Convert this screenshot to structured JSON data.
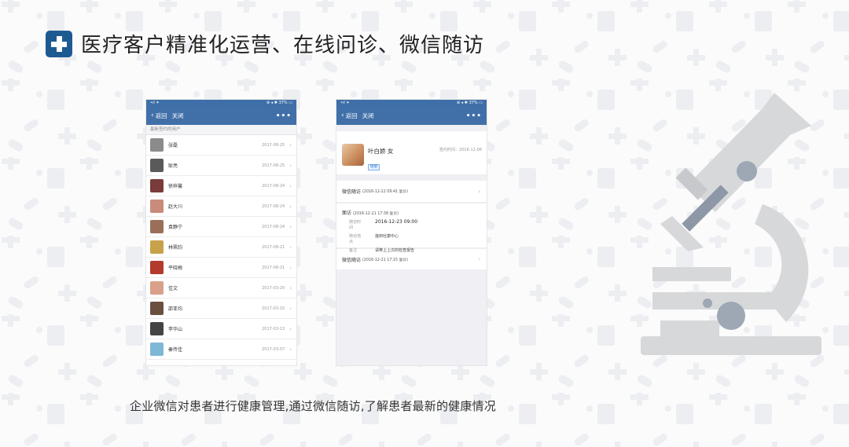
{
  "title": "医疗客户精准化运营、在线问诊、微信随访",
  "caption": "企业微信对患者进行健康管理,通过微信随访,了解患者最新的健康情况",
  "left_phone": {
    "status": {
      "left": "•ıl ✦",
      "right": "⊕ ◂ ✱ 37% ▭"
    },
    "nav": {
      "back": "返回",
      "close": "关闭",
      "more": "•••"
    },
    "section": "最新签约的用户",
    "users": [
      {
        "name": "张磊",
        "date": "2017-08-25",
        "color": "#8b8b8b"
      },
      {
        "name": "耿亮",
        "date": "2017-08-25",
        "color": "#5a5a5a"
      },
      {
        "name": "徐梓馨",
        "date": "2017-08-24",
        "color": "#7a3b3b"
      },
      {
        "name": "赵大川",
        "date": "2017-08-24",
        "color": "#c98c7a"
      },
      {
        "name": "袁静宁",
        "date": "2017-08-24",
        "color": "#9a6f5a"
      },
      {
        "name": "林珮钧",
        "date": "2017-08-21",
        "color": "#c7a24a"
      },
      {
        "name": "平晓梅",
        "date": "2017-08-21",
        "color": "#b33a2c"
      },
      {
        "name": "佳文",
        "date": "2017-03-20",
        "color": "#d9a08a"
      },
      {
        "name": "邵亚均",
        "date": "2017-03-15",
        "color": "#6b5040"
      },
      {
        "name": "李华山",
        "date": "2017-03-13",
        "color": "#444444"
      },
      {
        "name": "秦传佳",
        "date": "2017-03-07",
        "color": "#7fb7d6"
      }
    ]
  },
  "right_phone": {
    "status": {
      "left": "•ıl ✦",
      "right": "⊕ ◂ ✱ 37% ▭"
    },
    "nav": {
      "back": "返回",
      "close": "关闭",
      "more": "•••"
    },
    "profile": {
      "name": "叶白娇 女",
      "tag": "健康",
      "sign_label": "签约时间：2016-12-06"
    },
    "visit1": {
      "label": "微信随访",
      "date": "(2016-12-22 09:41 复诊)"
    },
    "meeting": {
      "label": "面访",
      "date": "(2016-12-21 17:38 复诊)",
      "time_key": "随访时间",
      "time_val": "2016-12-23 09:00",
      "place_key": "随访地点",
      "place_val": "莲田社康中心",
      "note_key": "备注",
      "note_val": "请带上上次的检查报告"
    },
    "visit2": {
      "label": "微信随访",
      "date": "(2016-12-21 17:15 复诊)"
    }
  }
}
